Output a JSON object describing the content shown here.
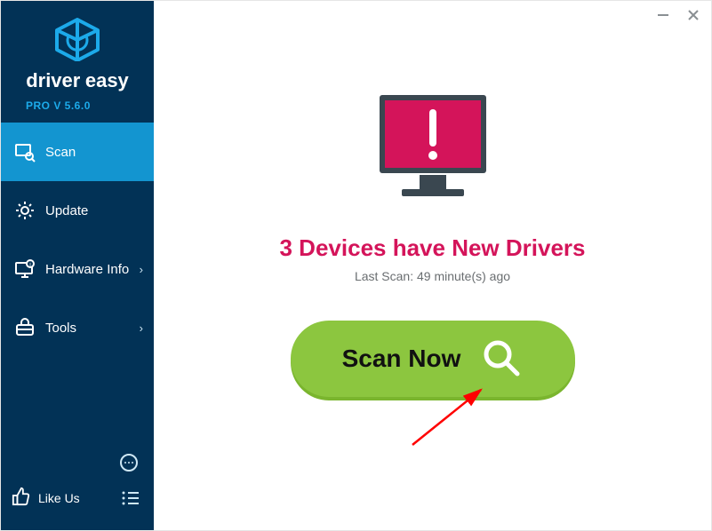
{
  "brand": {
    "name_top": "driver",
    "name_bottom": "easy",
    "version": "PRO V 5.6.0"
  },
  "sidebar": {
    "items": [
      {
        "label": "Scan",
        "has_sub": false,
        "active": true
      },
      {
        "label": "Update",
        "has_sub": false,
        "active": false
      },
      {
        "label": "Hardware Info",
        "has_sub": true,
        "active": false
      },
      {
        "label": "Tools",
        "has_sub": true,
        "active": false
      }
    ],
    "like_label": "Like Us"
  },
  "main": {
    "headline": "3 Devices have New Drivers",
    "subline": "Last Scan: 49 minute(s) ago",
    "scan_button": "Scan Now"
  },
  "colors": {
    "accent_pink": "#d4145a",
    "accent_green": "#8cc63f",
    "sidebar_bg": "#023256",
    "sidebar_active": "#1395d0"
  }
}
